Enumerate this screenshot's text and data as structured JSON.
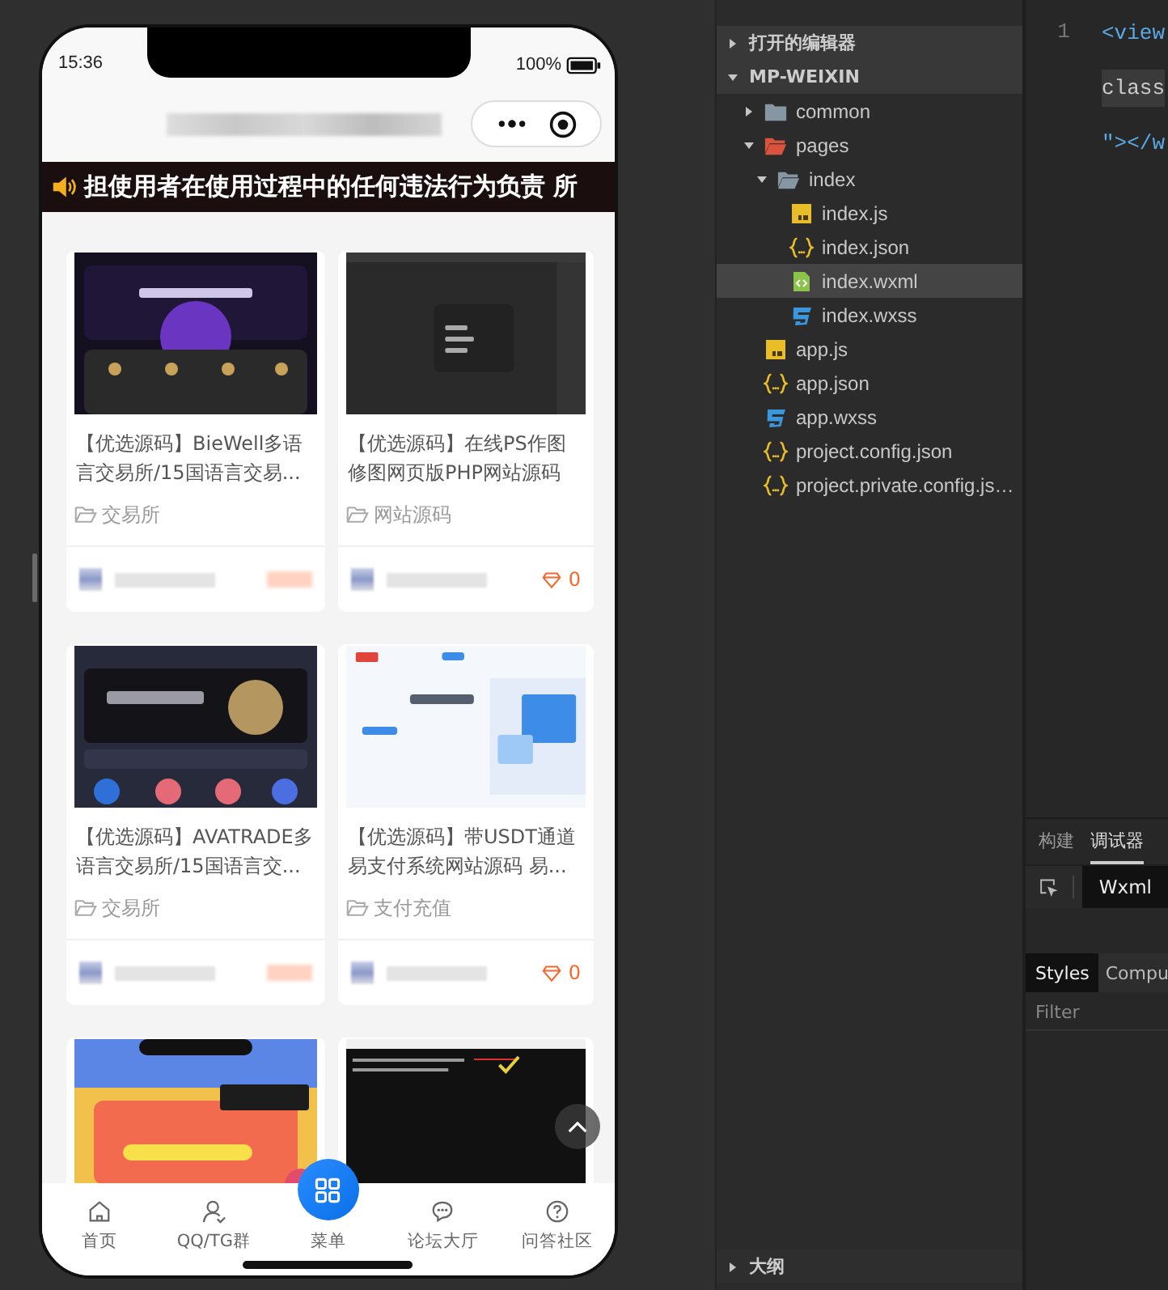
{
  "phone": {
    "status_bar": {
      "time": "15:36",
      "battery": "100%"
    },
    "notice": "担使用者在使用过程中的任何违法行为负责 所",
    "cards": [
      {
        "kind": "post",
        "title": "【优选源码】BieWell多语言交易所/15国语言交易...",
        "category": "交易所"
      },
      {
        "kind": "post",
        "title": "【优选源码】在线PS作图修图网页版PHP网站源码",
        "category": "网站源码",
        "likes": "0"
      },
      {
        "kind": "post",
        "title": "【优选源码】AVATRADE多语言交易所/15国语言交...",
        "category": "交易所"
      },
      {
        "kind": "post",
        "title": "【优选源码】带USDT通道易支付系统网站源码 易...",
        "category": "支付充值",
        "likes": "0"
      },
      {
        "kind": "picture"
      },
      {
        "kind": "picture"
      }
    ],
    "tab_bar": [
      {
        "label": "首页",
        "kind": "home"
      },
      {
        "label": "QQ/TG群",
        "kind": "person"
      },
      {
        "label": "菜单",
        "kind": "menu"
      },
      {
        "label": "论坛大厅",
        "kind": "chat"
      },
      {
        "label": "问答社区",
        "kind": "help"
      }
    ]
  },
  "explorer": {
    "sections": [
      {
        "label": "打开的编辑器",
        "expanded": false
      },
      {
        "label": "MP-WEIXIN",
        "expanded": true
      }
    ],
    "tree": [
      {
        "label": "common",
        "kind": "folder",
        "expanded": false,
        "selected": false
      },
      {
        "label": "pages",
        "kind": "special-folder",
        "expanded": true,
        "selected": false,
        "children": [
          {
            "label": "index",
            "kind": "folder",
            "expanded": true,
            "selected": false,
            "children": [
              {
                "label": "index.js",
                "kind": "js",
                "selected": false
              },
              {
                "label": "index.json",
                "kind": "json",
                "selected": false
              },
              {
                "label": "index.wxml",
                "kind": "wxml",
                "selected": true
              },
              {
                "label": "index.wxss",
                "kind": "wxss",
                "selected": false
              }
            ]
          }
        ]
      },
      {
        "label": "app.js",
        "kind": "js",
        "selected": false
      },
      {
        "label": "app.json",
        "kind": "json",
        "selected": false
      },
      {
        "label": "app.wxss",
        "kind": "wxss",
        "selected": false
      },
      {
        "label": "project.config.json",
        "kind": "json",
        "selected": false
      },
      {
        "label": "project.private.config.js…",
        "kind": "json",
        "selected": false
      }
    ],
    "outline": {
      "label": "大纲",
      "expanded": false
    }
  },
  "editor": {
    "line_numbers": [
      "1"
    ],
    "code_lines": [
      {
        "text": "<view",
        "kind": "tag"
      },
      {
        "text": "class",
        "kind": "attr"
      },
      {
        "text": "\"></w",
        "kind": "tag"
      }
    ]
  },
  "debugger": {
    "tabs": [
      {
        "label": "构建",
        "selected": false
      },
      {
        "label": "调试器",
        "selected": true
      }
    ],
    "panel_tabs": [
      {
        "label": "Wxml",
        "selected": true
      }
    ],
    "style_tabs": [
      {
        "label": "Styles",
        "selected": true
      },
      {
        "label": "Compu",
        "selected": false
      }
    ],
    "filter_placeholder": "Filter"
  }
}
